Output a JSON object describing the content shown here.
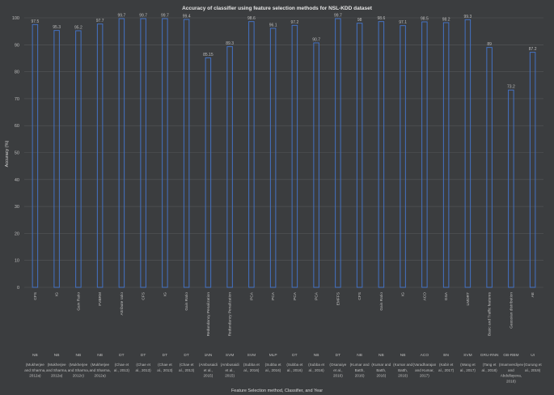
{
  "chart_data": {
    "type": "bar",
    "title": "Accuracy of classifier using feature selection methods for NSL-KDD dataset",
    "xlabel": "Feature Selection method, Classifier, and Year",
    "ylabel": "Accuracy (%)",
    "ylim": [
      0,
      100
    ],
    "yticks": [
      0,
      10,
      20,
      30,
      40,
      50,
      60,
      70,
      80,
      90,
      100
    ],
    "grid": "horizontal",
    "colors": {
      "background": "#3b3d3f",
      "bar_outline": "#4472c4",
      "grid": "#555759"
    },
    "categories": [
      {
        "method": "CFS",
        "classifier": "NB",
        "ref": "(Mukherjee and Sharma, 2012a)",
        "value": 97.5,
        "label": "97.5"
      },
      {
        "method": "IG",
        "classifier": "NB",
        "ref": "(Mukherjee and Sharma, 2012a)",
        "value": 95.3,
        "label": "95.3"
      },
      {
        "method": "Gain Ratio",
        "classifier": "NB",
        "ref": "(Mukherjee and Sharma, 2012c)",
        "value": 95.2,
        "label": "95.2"
      },
      {
        "method": "FVBRM",
        "classifier": "NB",
        "ref": "(Mukherjee and Sharma, 2012a)",
        "value": 97.7,
        "label": "97.7"
      },
      {
        "method": "Attribute ratio",
        "classifier": "DT",
        "ref": "(Chae et al., 2013)",
        "value": 99.7,
        "label": "99.7"
      },
      {
        "method": "CFS",
        "classifier": "DT",
        "ref": "(Chae et al., 2013)",
        "value": 99.7,
        "label": "99.7"
      },
      {
        "method": "IG",
        "classifier": "DT",
        "ref": "(Chae et al., 2013)",
        "value": 99.7,
        "label": "99.7"
      },
      {
        "method": "Gain Ratio",
        "classifier": "DT",
        "ref": "(Chae et al., 2013)",
        "value": 99.4,
        "label": "99.4"
      },
      {
        "method": "Redundancy Penalization",
        "classifier": "1NN",
        "ref": "(Ambusaidi et al., 2015)",
        "value": 85.15,
        "label": "85.15"
      },
      {
        "method": "Redundancy Penalization",
        "classifier": "SVM",
        "ref": "(Ambusaidi et al., 2015)",
        "value": 89.3,
        "label": "89.3"
      },
      {
        "method": "PCA",
        "classifier": "SVM",
        "ref": "(Subba et al., 2016)",
        "value": 98.6,
        "label": "98.6"
      },
      {
        "method": "PCA",
        "classifier": "MLP",
        "ref": "(Subba et al., 2016)",
        "value": 96.1,
        "label": "96.1"
      },
      {
        "method": "PCA",
        "classifier": "DT",
        "ref": "(Subba et al., 2016)",
        "value": 97.2,
        "label": "97.2"
      },
      {
        "method": "PCA",
        "classifier": "NB",
        "ref": "(Subba et al., 2016)",
        "value": 90.7,
        "label": "90.7"
      },
      {
        "method": "EMFFS",
        "classifier": "DT",
        "ref": "(Osanaiye et al., 2016)",
        "value": 99.7,
        "label": "99.7"
      },
      {
        "method": "CFS",
        "classifier": "NB",
        "ref": "(Kumar and Batth, 2016)",
        "value": 98,
        "label": "98"
      },
      {
        "method": "Gain Ratio",
        "classifier": "NB",
        "ref": "(Kumar and Batth, 2016)",
        "value": 98.6,
        "label": "98.6"
      },
      {
        "method": "IG",
        "classifier": "NB",
        "ref": "(Kumar and Batth, 2016)",
        "value": 97.1,
        "label": "97.1"
      },
      {
        "method": "ACO",
        "classifier": "ACO",
        "ref": "(Varadharajan and Kumar, 2017)",
        "value": 98.5,
        "label": "98.5"
      },
      {
        "method": "GSA",
        "classifier": "BN",
        "ref": "(Kabir et al., 2017)",
        "value": 98.2,
        "label": "98.2"
      },
      {
        "method": "LMDRT",
        "classifier": "SVM",
        "ref": "(Wang et al., 2017)",
        "value": 99.3,
        "label": "99.3"
      },
      {
        "method": "Basic and Traffic features",
        "classifier": "GRU-RNN",
        "ref": "(Tang et al., 2018)",
        "value": 89,
        "label": "89"
      },
      {
        "method": "Gaussian distribution",
        "classifier": "GB-RBM",
        "ref": "(Imamverdiyev and Abdullayeva, 2018)",
        "value": 73.2,
        "label": "73.2"
      },
      {
        "method": "AE",
        "classifier": "UI",
        "ref": "(Gurung et al., 2019)",
        "value": 87.2,
        "label": "87.2"
      }
    ]
  }
}
